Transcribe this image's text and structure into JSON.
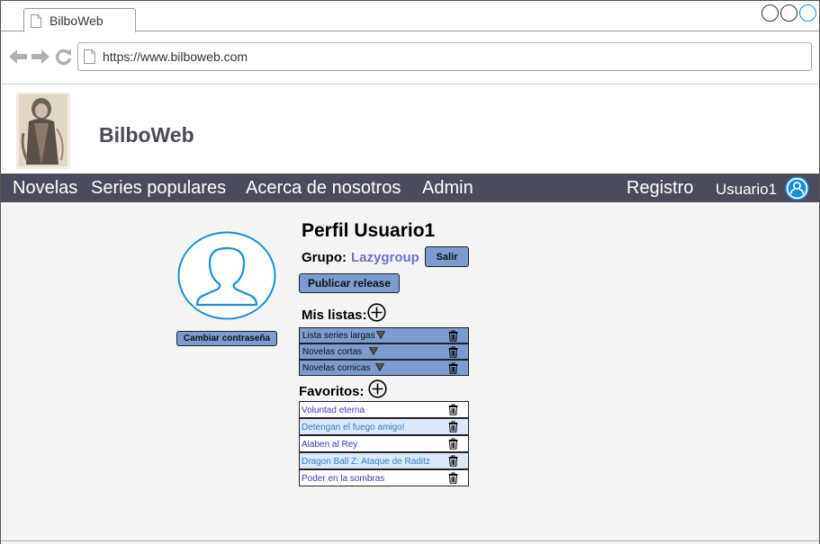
{
  "browser": {
    "tab_title": "BilboWeb",
    "url": "https://www.bilboweb.com"
  },
  "site": {
    "brand": "BilboWeb"
  },
  "nav": {
    "items": [
      {
        "label": "Novelas"
      },
      {
        "label": "Series populares"
      },
      {
        "label": "Acerca de nosotros"
      },
      {
        "label": "Admin"
      }
    ],
    "register": "Registro",
    "user": "Usuario1"
  },
  "profile": {
    "title": "Perfil Usuario1",
    "group_label": "Grupo:",
    "group_name": "Lazygroup",
    "leave_button": "Salir",
    "publish_button": "Publicar release",
    "change_password_button": "Cambiar contraseña",
    "lists_title": "Mis listas:",
    "lists": [
      {
        "label": "Lista series largas"
      },
      {
        "label": "Novelas cortas"
      },
      {
        "label": "Novelas comicas"
      }
    ],
    "favorites_title": "Favoritos:",
    "favorites": [
      {
        "label": "Voluntad eterna"
      },
      {
        "label": "Detengan el fuego amigo!"
      },
      {
        "label": "Alaben al Rey"
      },
      {
        "label": "Dragon Ball Z: Ataque de Raditz"
      },
      {
        "label": "Poder en la sombras"
      }
    ]
  },
  "colors": {
    "navbar": "#4b4b5e",
    "button_blue": "#7b9bd1",
    "group_link": "#6f6fd0",
    "avatar_blue": "#1a8fd6"
  }
}
